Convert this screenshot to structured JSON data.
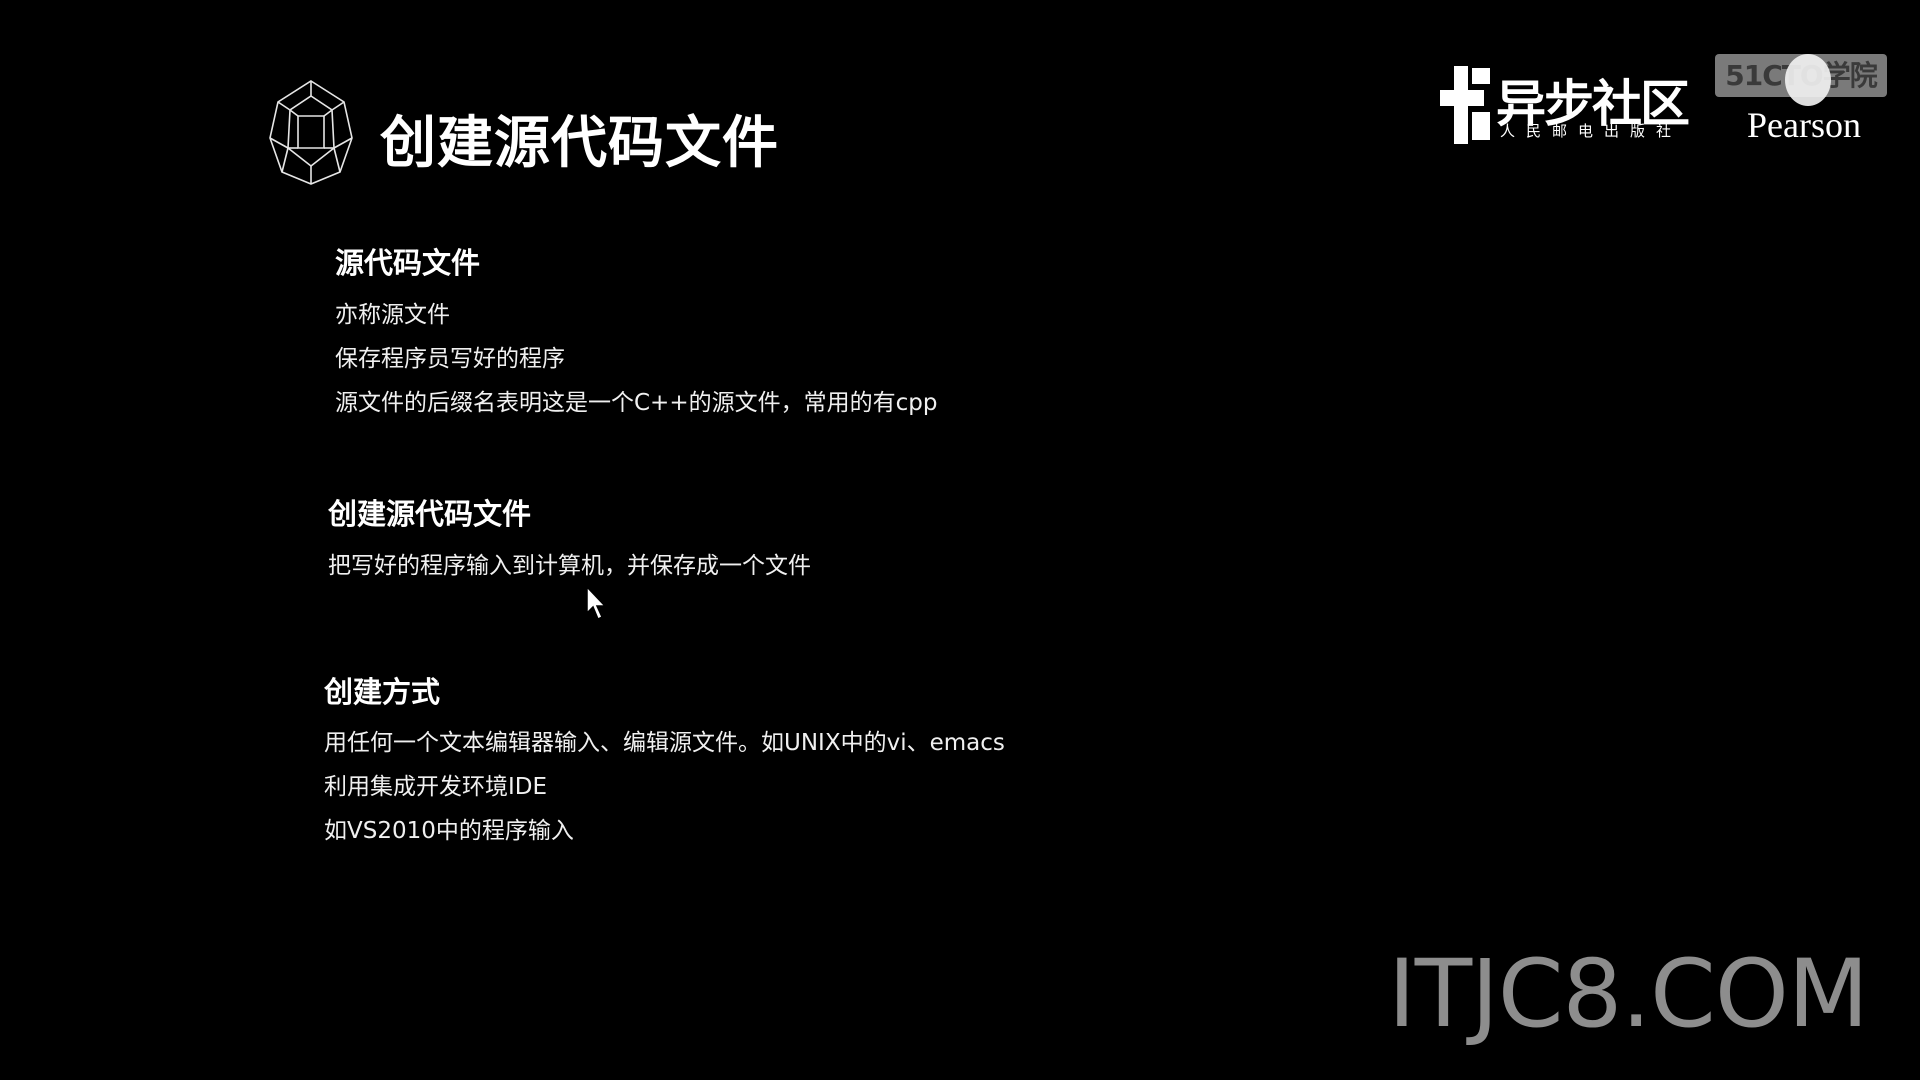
{
  "slide": {
    "title": "创建源代码文件",
    "sections": [
      {
        "heading": "源代码文件",
        "lines": [
          "亦称源文件",
          "保存程序员写好的程序",
          "源文件的后缀名表明这是一个C++的源文件，常用的有cpp"
        ]
      },
      {
        "heading": "创建源代码文件",
        "lines": [
          "把写好的程序输入到计算机，并保存成一个文件"
        ]
      },
      {
        "heading": "创建方式",
        "lines": [
          "用任何一个文本编辑器输入、编辑源文件。如UNIX中的vi、emacs",
          "利用集成开发环境IDE",
          "如VS2010中的程序输入"
        ]
      }
    ]
  },
  "logos": {
    "yibu_main": "异步社区",
    "yibu_sub": "人民邮电出版社",
    "badge_51cto": "51CTO学院",
    "pearson": "Pearson"
  },
  "watermark": "ITJC8.COM",
  "icons": {
    "title_icon": "polyhedron-wireframe-icon",
    "cursor": "mouse-pointer-icon"
  }
}
